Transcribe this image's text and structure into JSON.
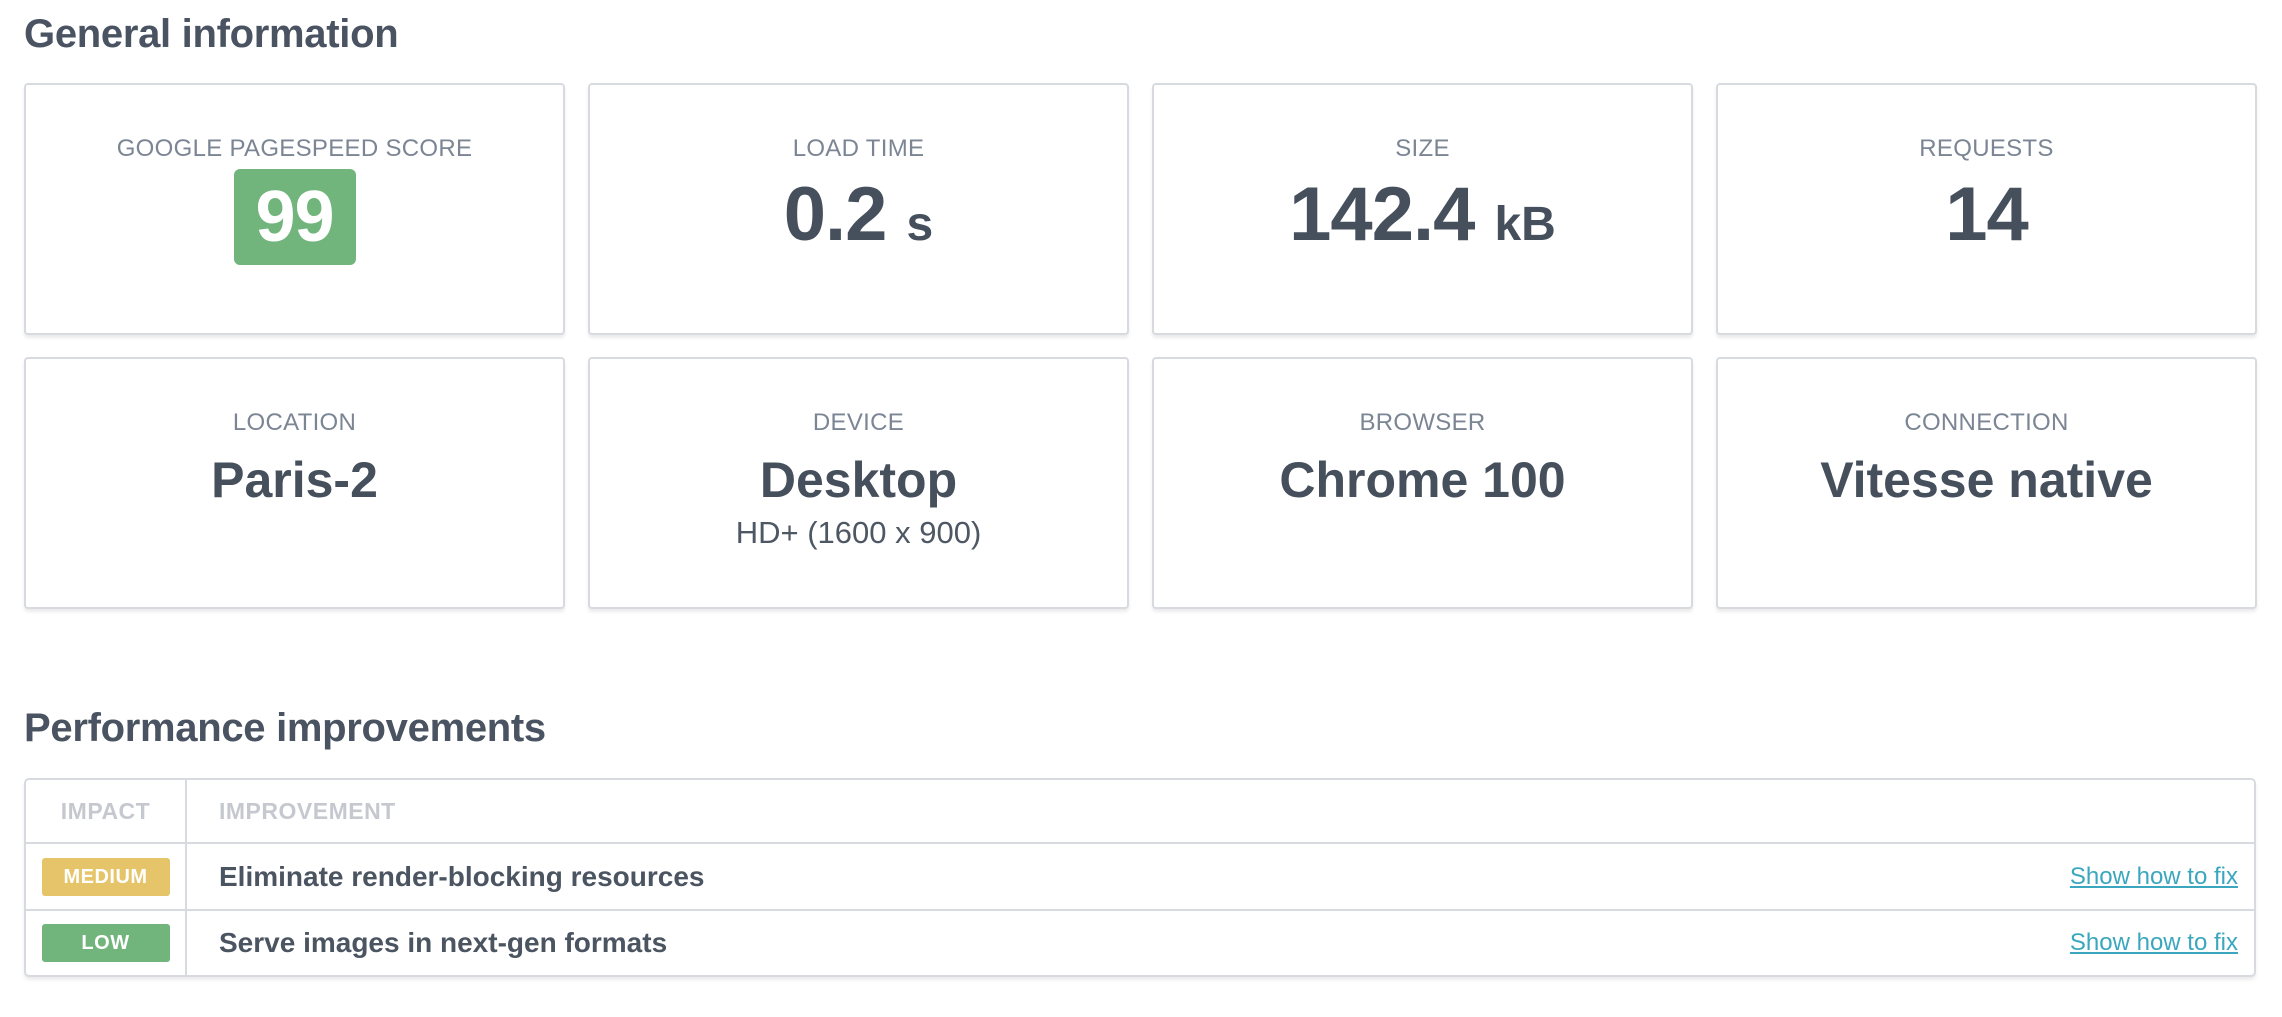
{
  "general": {
    "title": "General information",
    "metrics": [
      {
        "label": "GOOGLE PAGESPEED SCORE",
        "value": "99",
        "badge_color": "#72b57c"
      },
      {
        "label": "LOAD TIME",
        "value": "0.2",
        "unit": "s"
      },
      {
        "label": "SIZE",
        "value": "142.4",
        "unit": "kB"
      },
      {
        "label": "REQUESTS",
        "value": "14"
      },
      {
        "label": "LOCATION",
        "value": "Paris-2"
      },
      {
        "label": "DEVICE",
        "value": "Desktop",
        "sub": "HD+ (1600 x 900)"
      },
      {
        "label": "BROWSER",
        "value": "Chrome 100"
      },
      {
        "label": "CONNECTION",
        "value": "Vitesse native"
      }
    ]
  },
  "performance": {
    "title": "Performance improvements",
    "columns": {
      "impact": "IMPACT",
      "improvement": "IMPROVEMENT"
    },
    "rows": [
      {
        "impact": "MEDIUM",
        "impact_color": "#e6c46a",
        "improvement": "Eliminate render-blocking resources",
        "link": "Show how to fix"
      },
      {
        "impact": "LOW",
        "impact_color": "#72b57c",
        "improvement": "Serve images in next-gen formats",
        "link": "Show how to fix"
      }
    ]
  }
}
